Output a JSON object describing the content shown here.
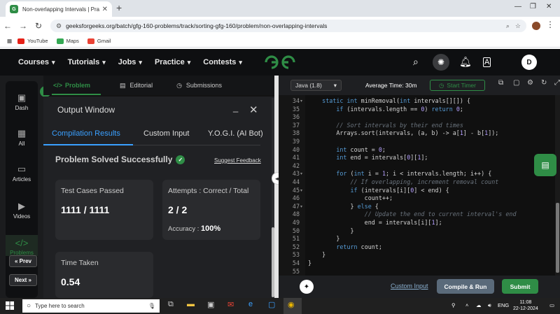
{
  "browser": {
    "tab_title": "Non-overlapping Intervals | Pra",
    "url": "geeksforgeeks.org/batch/gfg-160-problems/track/sorting-gfg-160/problem/non-overlapping-intervals",
    "bookmarks": [
      "YouTube",
      "Maps",
      "Gmail"
    ]
  },
  "header": {
    "nav": [
      "Courses",
      "Tutorials",
      "Jobs",
      "Practice",
      "Contests"
    ],
    "user_initial": "D"
  },
  "sidebar": {
    "items": [
      "Dash",
      "All",
      "Articles",
      "Videos",
      "Problems"
    ],
    "prev": "« Prev",
    "next": "Next »"
  },
  "problem_tabs": [
    "Problem",
    "Editorial",
    "Submissions"
  ],
  "output": {
    "title": "Output Window",
    "tabs": [
      "Compilation Results",
      "Custom Input",
      "Y.O.G.I. (AI Bot)"
    ],
    "status": "Problem Solved Successfully",
    "feedback": "Suggest Feedback",
    "test_cases_label": "Test Cases Passed",
    "test_cases_value": "1111 / 1111",
    "attempts_label": "Attempts : Correct / Total",
    "attempts_value": "2 / 2",
    "accuracy_label": "Accuracy :",
    "accuracy_value": "100%",
    "time_label": "Time Taken",
    "time_value": "0.54"
  },
  "editor": {
    "language": "Java (1.8)",
    "avg_time": "Average Time: 30m",
    "timer": "Start Timer",
    "line_numbers": [
      "34",
      "35",
      "36",
      "37",
      "38",
      "39",
      "40",
      "41",
      "42",
      "43",
      "44",
      "45",
      "46",
      "47",
      "48",
      "49",
      "50",
      "51",
      "52",
      "53",
      "54",
      "55"
    ],
    "lines": [
      "    static int minRemoval(int intervals[][]) {",
      "        if (intervals.length == 0) return 0;",
      "",
      "        // Sort intervals by their end times",
      "        Arrays.sort(intervals, (a, b) -> a[1] - b[1]);",
      "",
      "        int count = 0;",
      "        int end = intervals[0][1];",
      "",
      "        for (int i = 1; i < intervals.length; i++) {",
      "            // If overlapping, increment removal count",
      "            if (intervals[i][0] < end) {",
      "                count++;",
      "            } else {",
      "                // Update the end to current interval's end",
      "                end = intervals[i][1];",
      "            }",
      "        }",
      "        return count;",
      "    }",
      "}",
      ""
    ],
    "custom_input": "Custom Input",
    "run": "Compile & Run",
    "submit": "Submit"
  },
  "taskbar": {
    "search_placeholder": "Type here to search",
    "lang": "ENG",
    "time": "11:08",
    "date": "22-12-2024"
  }
}
